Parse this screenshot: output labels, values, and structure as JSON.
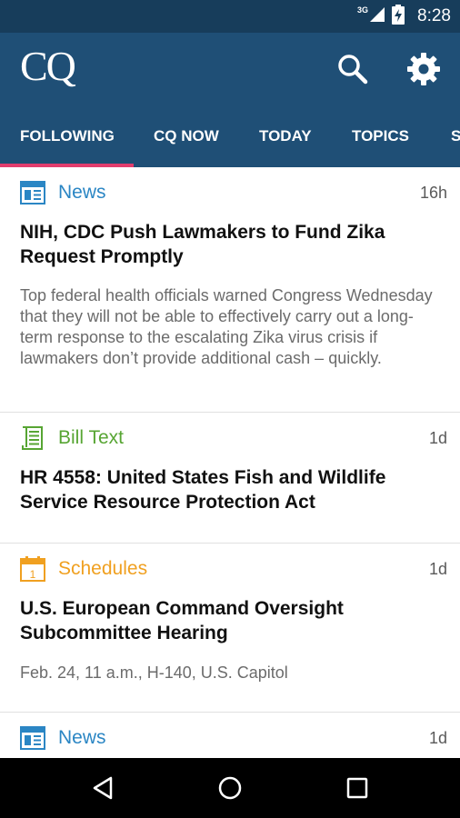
{
  "status_bar": {
    "network": "3G",
    "time": "8:28",
    "icons": [
      "signal-icon",
      "battery-charging-icon"
    ]
  },
  "app_bar": {
    "logo": "CQ",
    "icons": [
      "search-icon",
      "settings-gear-icon"
    ]
  },
  "tabs": [
    {
      "label": "FOLLOWING",
      "selected": true
    },
    {
      "label": "CQ NOW",
      "selected": false
    },
    {
      "label": "TODAY",
      "selected": false
    },
    {
      "label": "TOPICS",
      "selected": false
    },
    {
      "label": "S",
      "selected": false
    }
  ],
  "colors": {
    "status_bar": "#173d5b",
    "app_bar": "#1f4f76",
    "tab_indicator": "#e23d6e",
    "news": "#2b86c4",
    "bill_text": "#57a533",
    "schedules": "#f0a020"
  },
  "feed": [
    {
      "type": "News",
      "icon": "news-icon",
      "time": "16h",
      "title": "NIH, CDC Push Lawmakers to Fund Zika Request Promptly",
      "body": "Top federal health officials warned Congress Wednesday that they will not be able to effectively carry out a long-term response to the escalating Zika virus crisis if lawmakers don’t provide additional cash – quickly."
    },
    {
      "type": "Bill Text",
      "icon": "document-icon",
      "time": "1d",
      "title": "HR 4558: United States Fish and Wildlife Service Resource Protection Act",
      "body": ""
    },
    {
      "type": "Schedules",
      "icon": "calendar-icon",
      "time": "1d",
      "title": "U.S. European Command Oversight Subcommittee Hearing",
      "body": "Feb. 24, 11 a.m., H-140, U.S. Capitol"
    },
    {
      "type": "News",
      "icon": "news-icon",
      "time": "1d",
      "title": "",
      "body": ""
    }
  ],
  "nav_bar": {
    "icons": [
      "back-icon",
      "home-icon",
      "recents-icon"
    ]
  }
}
